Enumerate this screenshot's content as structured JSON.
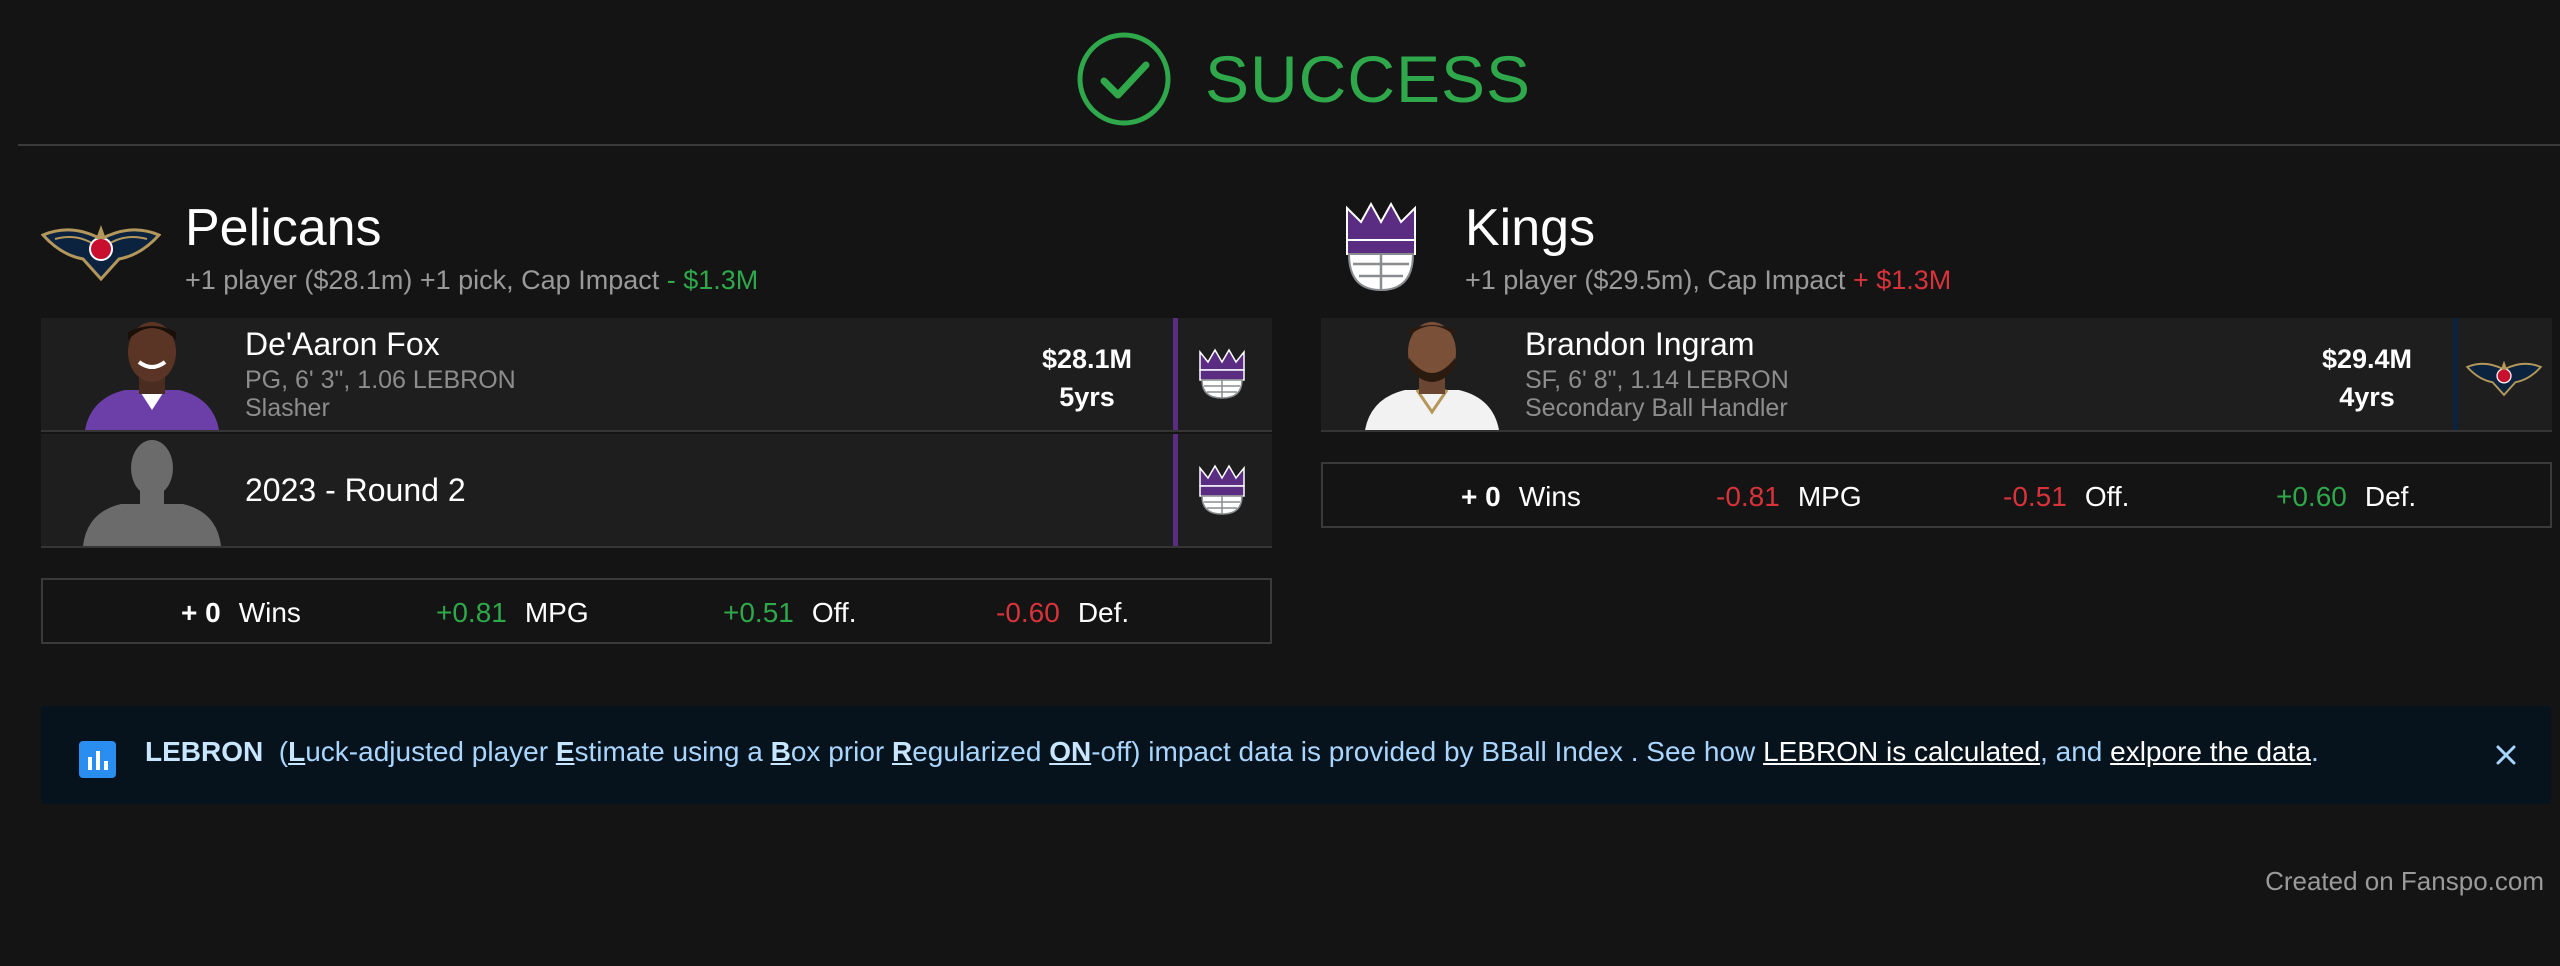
{
  "header": {
    "status": "SUCCESS",
    "status_color": "#2ea84a"
  },
  "left_team": {
    "name": "Pelicans",
    "sub_prefix": "+1 player ($28.1m) +1 pick, Cap Impact ",
    "cap_impact": "- $1.3M",
    "logo_icon": "pelicans-logo",
    "assets": [
      {
        "name": "De'Aaron Fox",
        "meta1": "PG, 6' 3\", 1.06 LEBRON",
        "meta2": "Slasher",
        "salary": "$28.1M",
        "years": "5yrs",
        "from_team_icon": "kings-logo",
        "bar_color": "#5a2d82"
      },
      {
        "name": "2023 - Round 2",
        "from_team_icon": "kings-logo",
        "bar_color": "#5a2d82"
      }
    ],
    "stats": {
      "wins_value": "+ 0",
      "wins_label": "Wins",
      "mpg_value": "+0.81",
      "mpg_label": "MPG",
      "off_value": "+0.51",
      "off_label": "Off.",
      "def_value": "-0.60",
      "def_label": "Def."
    }
  },
  "right_team": {
    "name": "Kings",
    "sub_prefix": "+1 player ($29.5m), Cap Impact ",
    "cap_impact": "+ $1.3M",
    "logo_icon": "kings-logo",
    "assets": [
      {
        "name": "Brandon Ingram",
        "meta1": "SF, 6' 8\", 1.14 LEBRON",
        "meta2": "Secondary Ball Handler",
        "salary": "$29.4M",
        "years": "4yrs",
        "from_team_icon": "pelicans-logo",
        "bar_color": "#0c2340"
      }
    ],
    "stats": {
      "wins_value": "+ 0",
      "wins_label": "Wins",
      "mpg_value": "-0.81",
      "mpg_label": "MPG",
      "off_value": "-0.51",
      "off_label": "Off.",
      "def_value": "+0.60",
      "def_label": "Def."
    }
  },
  "banner": {
    "title": "LEBRON",
    "open_paren": "(",
    "l": "L",
    "uck": "uck-adjusted player ",
    "e": "E",
    "stimate": "stimate using a ",
    "b": "B",
    "ox": "ox prior ",
    "r": "R",
    "egularized": "egularized ",
    "on": "ON",
    "off_tail": "-off) impact data is provided by BBall Index . See how ",
    "link1": "LEBRON is calculated",
    "mid": ", and ",
    "link2": "exlpore the data",
    "end": ".",
    "icon": "bar-chart-icon"
  },
  "footer": {
    "credit": "Created on Fanspo.com"
  }
}
